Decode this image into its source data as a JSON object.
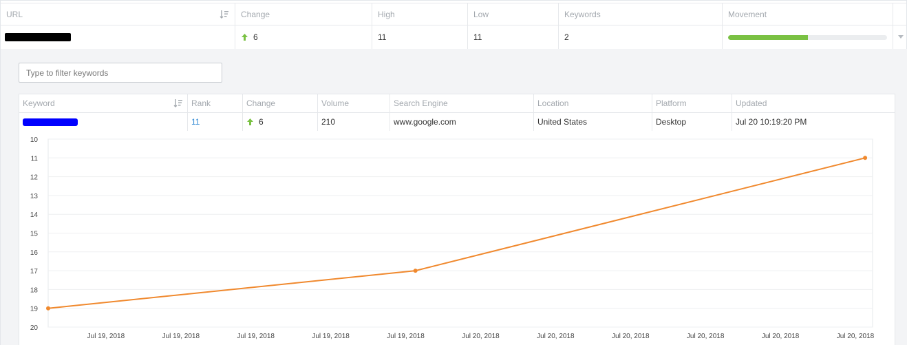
{
  "outer_table": {
    "headers": {
      "url": "URL",
      "change": "Change",
      "high": "High",
      "low": "Low",
      "keywords": "Keywords",
      "movement": "Movement"
    },
    "row": {
      "change": "6",
      "high": "11",
      "low": "11",
      "keywords": "2",
      "movement_progress": 0.5
    }
  },
  "filter": {
    "placeholder": "Type to filter keywords"
  },
  "keyword_table": {
    "headers": {
      "keyword": "Keyword",
      "rank": "Rank",
      "change": "Change",
      "volume": "Volume",
      "search_engine": "Search Engine",
      "location": "Location",
      "platform": "Platform",
      "updated": "Updated"
    },
    "row": {
      "rank": "11",
      "change": "6",
      "volume": "210",
      "search_engine": "www.google.com",
      "location": "United States",
      "platform": "Desktop",
      "updated": "Jul 20 10:19:20 PM"
    }
  },
  "colors": {
    "accent": "#f0892e",
    "up_arrow": "#7ac143",
    "progress": "#7ac143",
    "link": "#3a8fd6"
  },
  "chart_data": {
    "type": "line",
    "x": [
      "Jul 19, 2018",
      "Jul 19, 2018",
      "Jul 19, 2018",
      "Jul 19, 2018",
      "Jul 19, 2018",
      "Jul 20, 2018",
      "Jul 20, 2018",
      "Jul 20, 2018",
      "Jul 20, 2018",
      "Jul 20, 2018",
      "Jul 20, 2018"
    ],
    "series": [
      {
        "points": [
          {
            "x": 0,
            "y": 19
          },
          {
            "x": 4.9,
            "y": 17
          },
          {
            "x": 10.9,
            "y": 11
          }
        ]
      }
    ],
    "yticks": [
      10,
      11,
      12,
      13,
      14,
      15,
      16,
      17,
      18,
      19,
      20
    ],
    "ylim": [
      10,
      20
    ],
    "y_inverted": true,
    "grid": true,
    "title": "",
    "xlabel": "",
    "ylabel": ""
  }
}
